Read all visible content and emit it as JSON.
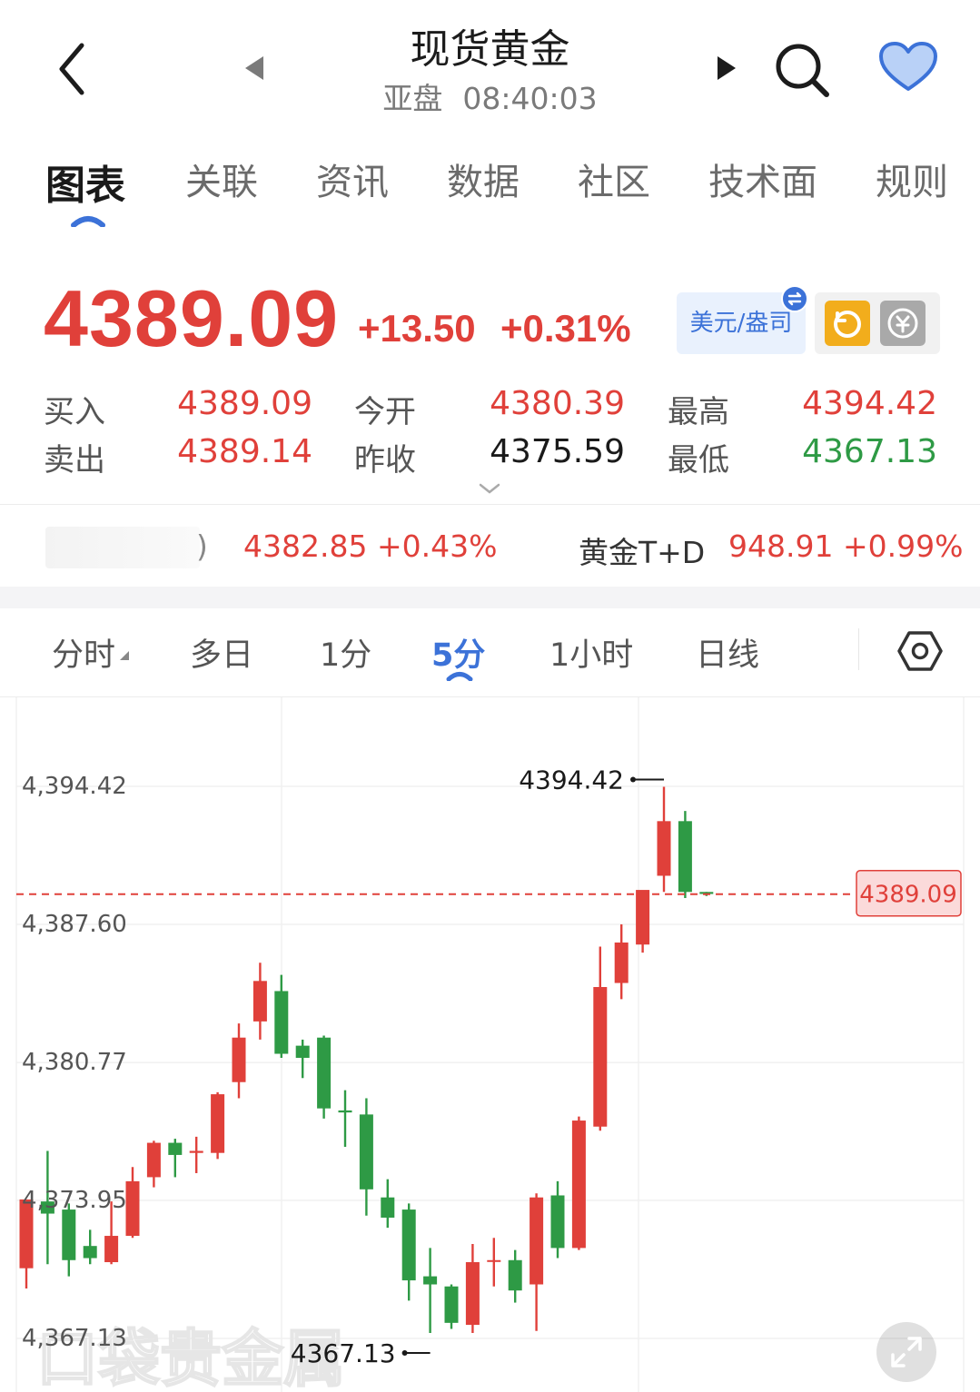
{
  "header": {
    "title": "现货黄金",
    "session": "亚盘",
    "time": "08:40:03"
  },
  "tabs": [
    {
      "label": "图表",
      "active": true
    },
    {
      "label": "关联",
      "active": false
    },
    {
      "label": "资讯",
      "active": false
    },
    {
      "label": "数据",
      "active": false
    },
    {
      "label": "社区",
      "active": false
    },
    {
      "label": "技术面",
      "active": false
    },
    {
      "label": "规则",
      "active": false
    }
  ],
  "price": {
    "last": "4389.09",
    "change": "+13.50",
    "change_pct": "+0.31%",
    "unit": "美元/盎司"
  },
  "quote": {
    "buy_label": "买入",
    "buy": "4389.09",
    "sell_label": "卖出",
    "sell": "4389.14",
    "open_label": "今开",
    "open": "4380.39",
    "prev_close_label": "昨收",
    "prev_close": "4375.59",
    "high_label": "最高",
    "high": "4394.42",
    "low_label": "最低",
    "low": "4367.13"
  },
  "related": [
    {
      "name": ")",
      "price": "4382.85",
      "change_pct": "+0.43%"
    },
    {
      "name": "黄金T+D",
      "price": "948.91",
      "change_pct": "+0.99%"
    }
  ],
  "periods": [
    {
      "label": "分时",
      "active": false
    },
    {
      "label": "多日",
      "active": false
    },
    {
      "label": "1分",
      "active": false
    },
    {
      "label": "5分",
      "active": true
    },
    {
      "label": "1小时",
      "active": false
    },
    {
      "label": "日线",
      "active": false
    }
  ],
  "colors": {
    "up": "#e0403a",
    "down": "#2e9a45",
    "accent": "#3c72d8"
  },
  "icons": {
    "back": "chevron-left-icon",
    "prev": "triangle-left-icon",
    "next": "triangle-right-icon",
    "search": "search-icon",
    "favorite": "heart-icon",
    "settings": "hexagon-settings-icon",
    "expand": "expand-icon"
  },
  "watermark": "口袋贵金属",
  "chart_data": {
    "type": "candlestick",
    "y_ticks": [
      "4,394.42",
      "4,387.60",
      "4,380.77",
      "4,373.95",
      "4,367.13"
    ],
    "ylim": [
      4367.13,
      4394.42
    ],
    "current_price": 4389.09,
    "current_price_label": "4389.09",
    "high_annotation": "4394.42",
    "low_annotation": "4367.13",
    "candles": [
      {
        "o": 4370.6,
        "h": 4373.9,
        "l": 4369.6,
        "c": 4374.0
      },
      {
        "o": 4373.9,
        "h": 4376.4,
        "l": 4370.8,
        "c": 4373.3
      },
      {
        "o": 4373.5,
        "h": 4373.8,
        "l": 4370.2,
        "c": 4371.0
      },
      {
        "o": 4371.7,
        "h": 4372.5,
        "l": 4370.8,
        "c": 4371.1
      },
      {
        "o": 4370.9,
        "h": 4373.9,
        "l": 4370.8,
        "c": 4372.2
      },
      {
        "o": 4372.2,
        "h": 4375.6,
        "l": 4372.1,
        "c": 4374.9
      },
      {
        "o": 4375.1,
        "h": 4376.9,
        "l": 4374.6,
        "c": 4376.8
      },
      {
        "o": 4376.8,
        "h": 4377.0,
        "l": 4375.1,
        "c": 4376.2
      },
      {
        "o": 4376.3,
        "h": 4377.1,
        "l": 4375.3,
        "c": 4376.4
      },
      {
        "o": 4376.3,
        "h": 4379.3,
        "l": 4376.0,
        "c": 4379.2
      },
      {
        "o": 4379.8,
        "h": 4382.7,
        "l": 4379.0,
        "c": 4382.0
      },
      {
        "o": 4382.8,
        "h": 4385.7,
        "l": 4381.9,
        "c": 4384.8
      },
      {
        "o": 4384.3,
        "h": 4385.1,
        "l": 4381.0,
        "c": 4381.2
      },
      {
        "o": 4381.6,
        "h": 4381.9,
        "l": 4380.0,
        "c": 4381.0
      },
      {
        "o": 4382.0,
        "h": 4382.1,
        "l": 4378.0,
        "c": 4378.5
      },
      {
        "o": 4378.4,
        "h": 4379.4,
        "l": 4376.6,
        "c": 4378.3
      },
      {
        "o": 4378.2,
        "h": 4379.0,
        "l": 4373.2,
        "c": 4374.5
      },
      {
        "o": 4374.1,
        "h": 4375.0,
        "l": 4372.6,
        "c": 4373.1
      },
      {
        "o": 4373.5,
        "h": 4373.8,
        "l": 4369.0,
        "c": 4370.0
      },
      {
        "o": 4370.2,
        "h": 4371.6,
        "l": 4367.4,
        "c": 4369.8
      },
      {
        "o": 4369.7,
        "h": 4369.8,
        "l": 4367.6,
        "c": 4367.9
      },
      {
        "o": 4367.8,
        "h": 4371.8,
        "l": 4367.4,
        "c": 4370.9
      },
      {
        "o": 4371.0,
        "h": 4372.1,
        "l": 4369.7,
        "c": 4371.0
      },
      {
        "o": 4371.0,
        "h": 4371.5,
        "l": 4368.9,
        "c": 4369.5
      },
      {
        "o": 4369.8,
        "h": 4374.3,
        "l": 4367.5,
        "c": 4374.1
      },
      {
        "o": 4374.2,
        "h": 4374.9,
        "l": 4371.1,
        "c": 4371.6
      },
      {
        "o": 4371.6,
        "h": 4378.1,
        "l": 4371.5,
        "c": 4377.9
      },
      {
        "o": 4377.6,
        "h": 4386.5,
        "l": 4377.4,
        "c": 4384.5
      },
      {
        "o": 4384.7,
        "h": 4387.6,
        "l": 4383.9,
        "c": 4386.7
      },
      {
        "o": 4386.6,
        "h": 4389.2,
        "l": 4386.2,
        "c": 4389.3
      },
      {
        "o": 4390.0,
        "h": 4394.4,
        "l": 4389.2,
        "c": 4392.7
      },
      {
        "o": 4392.7,
        "h": 4393.2,
        "l": 4388.9,
        "c": 4389.2
      },
      {
        "o": 4389.2,
        "h": 4389.2,
        "l": 4389.0,
        "c": 4389.1
      }
    ]
  }
}
